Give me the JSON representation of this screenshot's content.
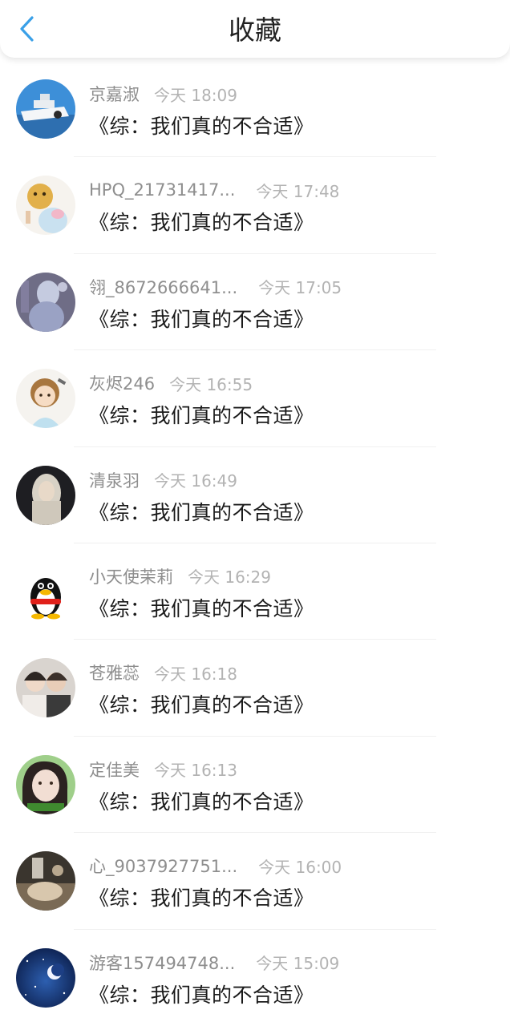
{
  "header": {
    "title": "收藏",
    "back_icon": "chevron-left-icon",
    "accent_color": "#3aa0e8"
  },
  "favorites": [
    {
      "user": "京嘉淑",
      "time": "今天 18:09",
      "title": "《综：我们真的不合适》"
    },
    {
      "user": "HPQ_21731417...",
      "time": "今天 17:48",
      "title": "《综：我们真的不合适》"
    },
    {
      "user": "翎_8672666641...",
      "time": "今天 17:05",
      "title": "《综：我们真的不合适》"
    },
    {
      "user": "灰烬246",
      "time": "今天 16:55",
      "title": "《综：我们真的不合适》"
    },
    {
      "user": "清泉羽",
      "time": "今天 16:49",
      "title": "《综：我们真的不合适》"
    },
    {
      "user": "小天使茉莉",
      "time": "今天 16:29",
      "title": "《综：我们真的不合适》"
    },
    {
      "user": "苍雅蕊",
      "time": "今天 16:18",
      "title": "《综：我们真的不合适》"
    },
    {
      "user": "定佳美",
      "time": "今天 16:13",
      "title": "《综：我们真的不合适》"
    },
    {
      "user": "心_9037927751...",
      "time": "今天 16:00",
      "title": "《综：我们真的不合适》"
    },
    {
      "user": "游客157494748...",
      "time": "今天 15:09",
      "title": "《综：我们真的不合适》"
    }
  ]
}
